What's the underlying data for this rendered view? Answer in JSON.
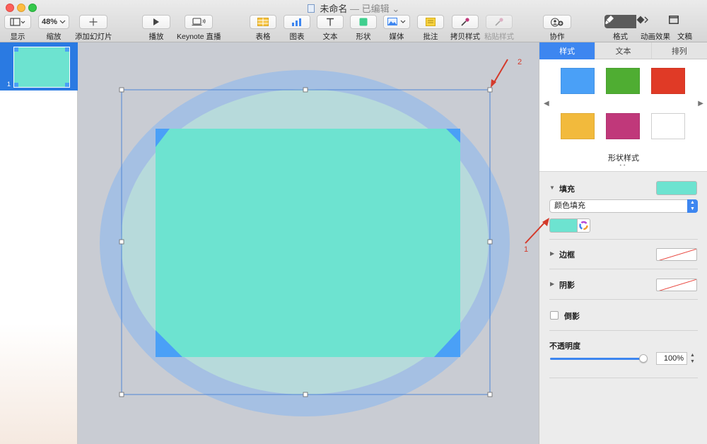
{
  "window": {
    "title": "未命名",
    "separator": "—",
    "status": "已编辑",
    "status_chevron": "⌄"
  },
  "toolbar": {
    "view_label": "显示",
    "zoom_value": "48%",
    "zoom_label": "缩放",
    "add_slide_label": "添加幻灯片",
    "play_label": "播放",
    "keynote_live_label": "Keynote 直播",
    "table_label": "表格",
    "chart_label": "图表",
    "text_label": "文本",
    "shape_label": "形状",
    "media_label": "媒体",
    "comment_label": "批注",
    "copy_style_label": "拷贝样式",
    "paste_style_label": "粘贴样式",
    "collaborate_label": "协作",
    "format_label": "格式",
    "animate_label": "动画效果",
    "document_label": "文稿"
  },
  "navigator": {
    "slides": [
      {
        "number": "1"
      }
    ]
  },
  "canvas": {
    "slide_color": "#c9ccd3",
    "ellipse_outer_color": "#a5c0e3",
    "ellipse_inner_color": "#b7dadb",
    "rect_color": "#6de3d0",
    "corner_color": "#4aa0f7"
  },
  "inspector": {
    "tabs": [
      {
        "label": "样式",
        "active": true
      },
      {
        "label": "文本",
        "active": false
      },
      {
        "label": "排列",
        "active": false
      }
    ],
    "shape_styles": {
      "caption": "形状样式",
      "swatches": [
        "#4aa0f7",
        "#4fad32",
        "#e03a26",
        "#f2ba3c",
        "#c0387a",
        "#ffffff"
      ],
      "prev_arrow": "◀",
      "next_arrow": "▶",
      "dots": "••"
    },
    "fill": {
      "title": "填充",
      "type": "颜色填充",
      "color": "#6de3d0"
    },
    "border": {
      "title": "边框"
    },
    "shadow": {
      "title": "阴影"
    },
    "reflection": {
      "title": "倒影"
    },
    "opacity": {
      "title": "不透明度",
      "value": "100%",
      "level": 1.0
    }
  },
  "annotations": {
    "marker_1": "1",
    "marker_2": "2"
  },
  "icons": {
    "view": "sidebar-icon",
    "add": "plus-icon",
    "play": "play-icon",
    "live": "display-broadcast-icon",
    "table": "table-icon",
    "chart": "bar-chart-icon",
    "text": "text-t-icon",
    "shape": "square-shape-icon",
    "media": "image-icon",
    "comment": "sticky-note-icon",
    "copy_style": "eyedropper-icon",
    "paste_style": "eyedropper-paste-icon",
    "collaborate": "add-person-icon",
    "format": "paintbrush-icon",
    "animate": "diamond-icon",
    "document": "document-frame-icon"
  }
}
